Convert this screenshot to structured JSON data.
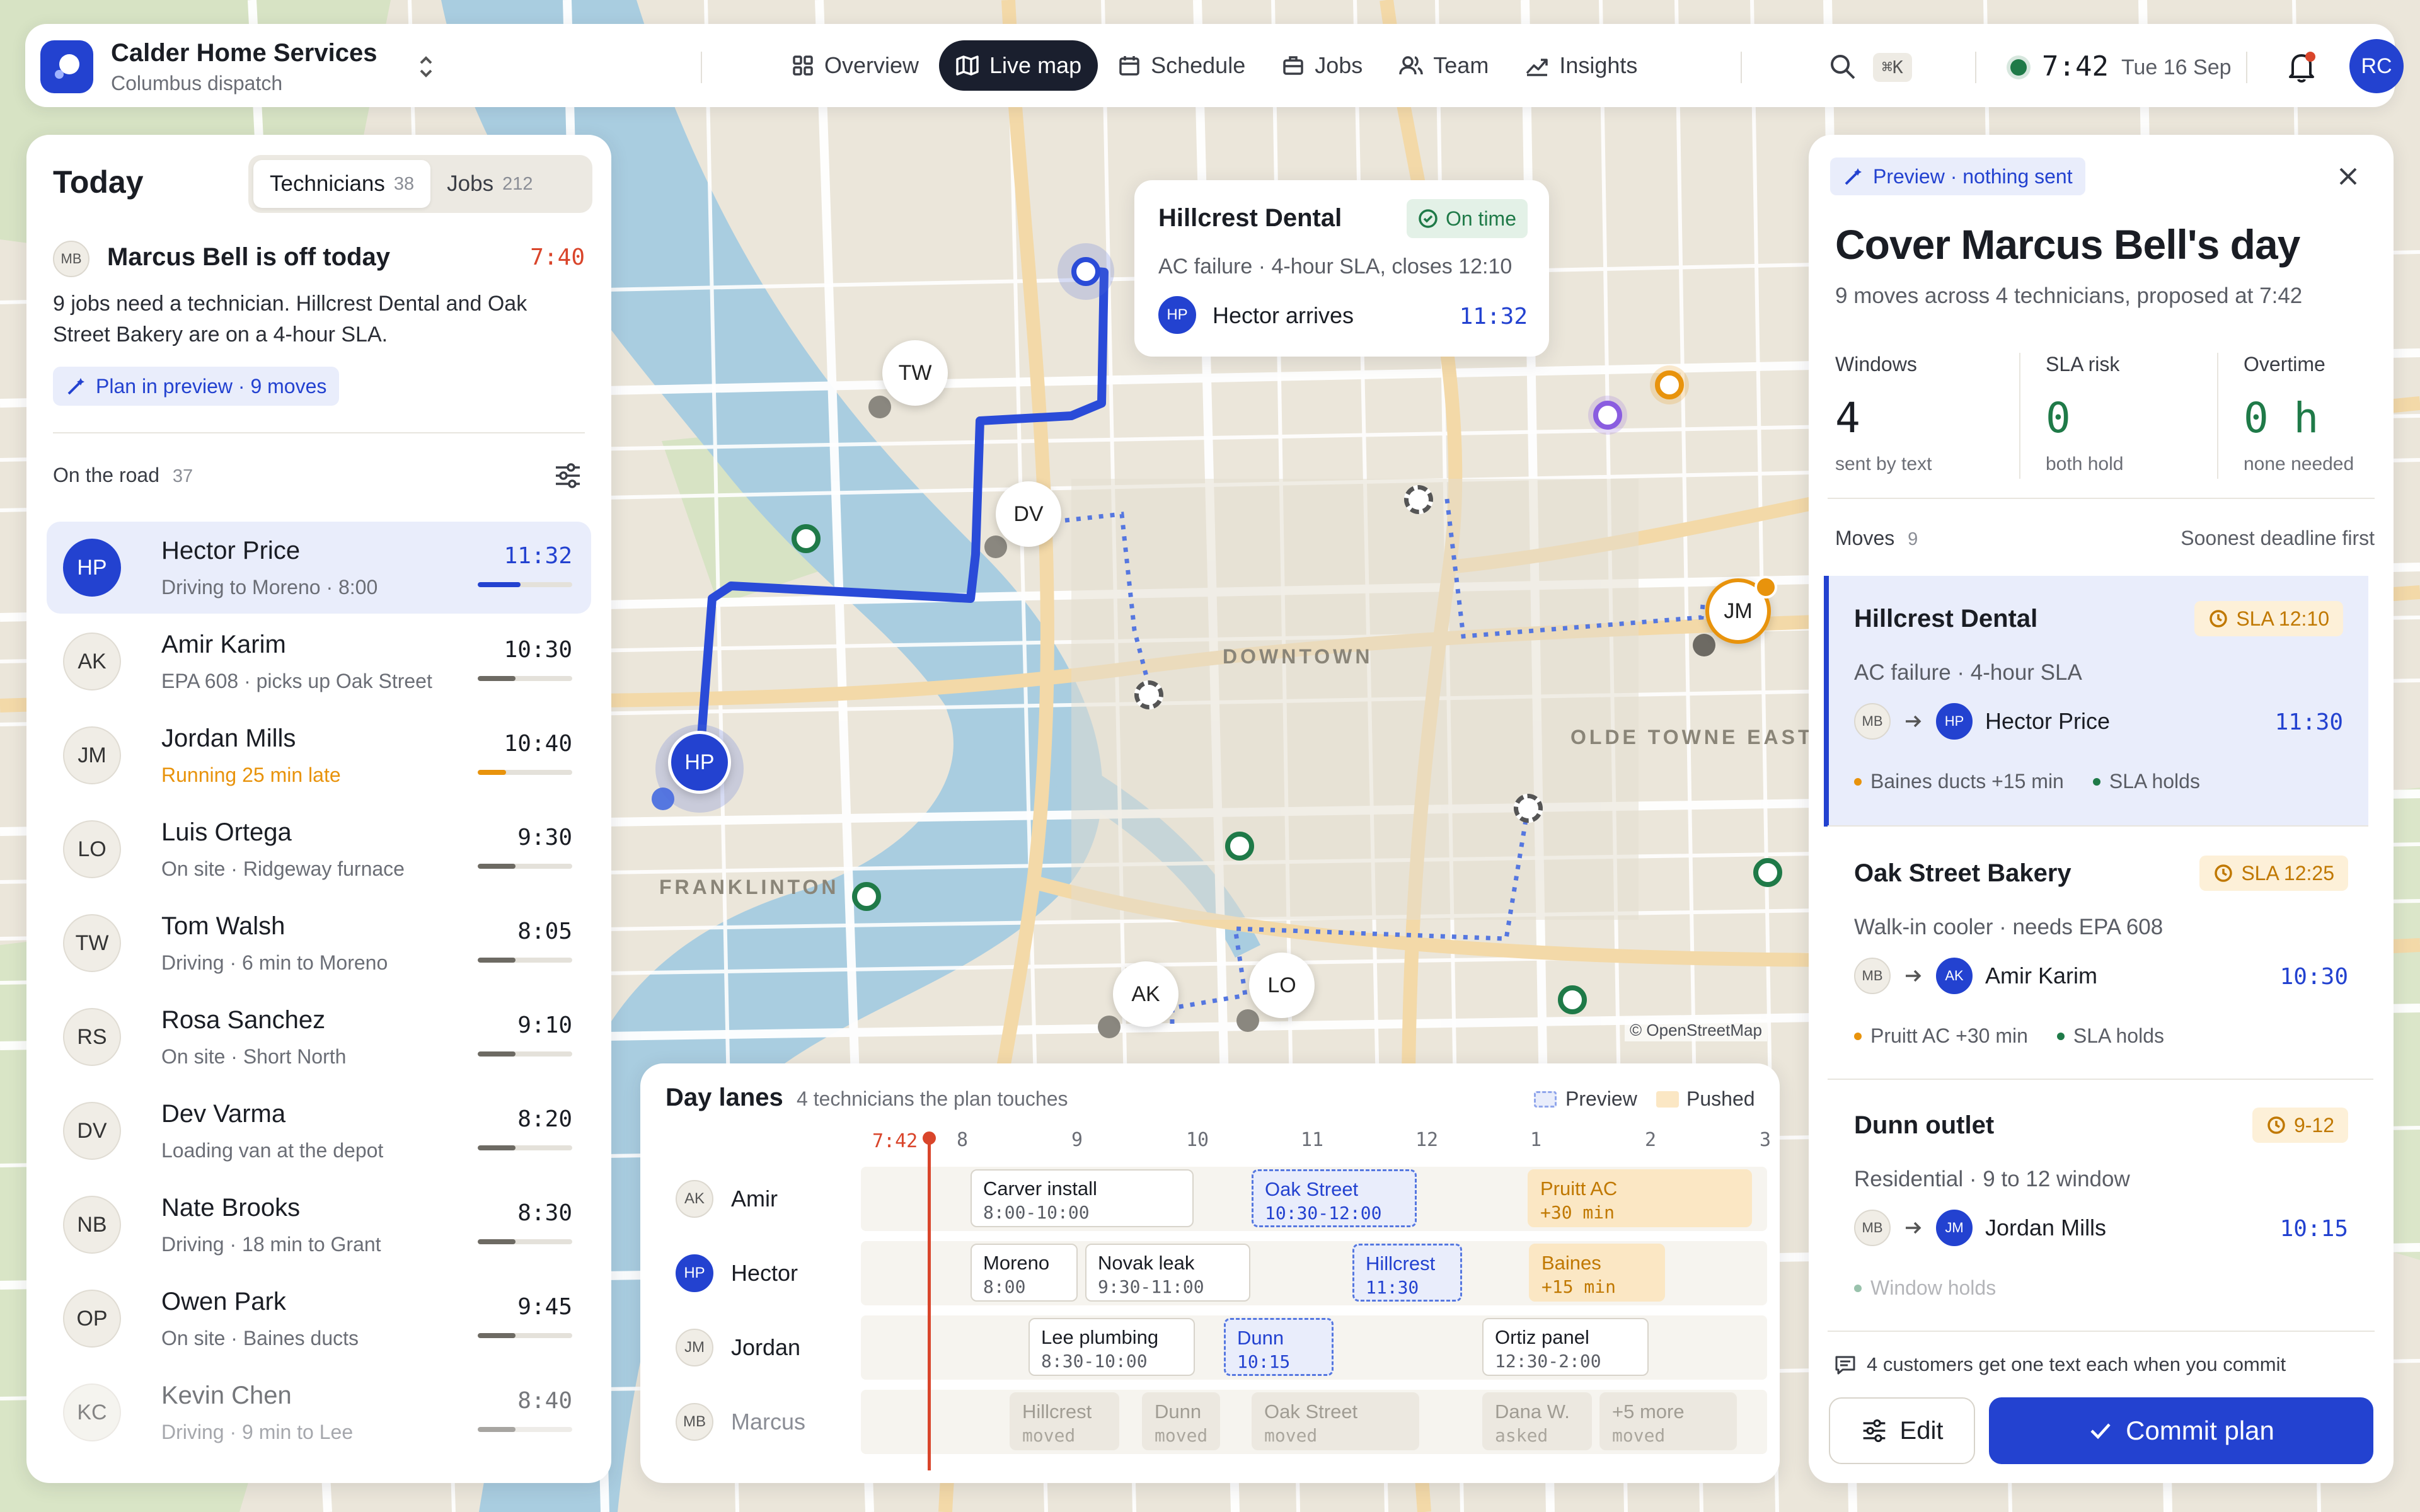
{
  "app": {
    "name": "Calder Home Services",
    "subtitle": "Columbus dispatch",
    "time": "7:42",
    "date": "Tue 16 Sep",
    "search_shortcut": "⌘K",
    "user_initials": "RC"
  },
  "nav": [
    {
      "label": "Overview",
      "icon": "grid-icon"
    },
    {
      "label": "Live map",
      "icon": "map-icon",
      "active": true
    },
    {
      "label": "Schedule",
      "icon": "calendar-icon"
    },
    {
      "label": "Jobs",
      "icon": "briefcase-icon"
    },
    {
      "label": "Team",
      "icon": "team-icon"
    },
    {
      "label": "Insights",
      "icon": "chart-icon"
    }
  ],
  "left": {
    "title": "Today",
    "tabs": [
      {
        "label": "Technicians",
        "count": "38"
      },
      {
        "label": "Jobs",
        "count": "212"
      }
    ],
    "alert": {
      "avatar": "MB",
      "title": "Marcus Bell is off today",
      "time": "7:40",
      "body": "9 jobs need a technician. Hillcrest Dental and Oak Street Bakery are on a 4-hour SLA.",
      "action": "Plan in preview · 9 moves"
    },
    "on_road_label": "On the road",
    "on_road_count": "37",
    "technicians": [
      {
        "initials": "HP",
        "name": "Hector Price",
        "status": "Driving to Moreno · 8:00",
        "time": "11:32",
        "progress": 0.45,
        "selected": true
      },
      {
        "initials": "AK",
        "name": "Amir Karim",
        "status": "EPA 608 · picks up Oak Street",
        "time": "10:30",
        "progress": 0.4
      },
      {
        "initials": "JM",
        "name": "Jordan Mills",
        "status": "Running 25 min late",
        "time": "10:40",
        "progress": 0.3,
        "late": true
      },
      {
        "initials": "LO",
        "name": "Luis Ortega",
        "status": "On site · Ridgeway furnace",
        "time": "9:30",
        "progress": 0.4
      },
      {
        "initials": "TW",
        "name": "Tom Walsh",
        "status": "Driving · 6 min to Moreno",
        "time": "8:05",
        "progress": 0.4
      },
      {
        "initials": "RS",
        "name": "Rosa Sanchez",
        "status": "On site · Short North",
        "time": "9:10",
        "progress": 0.4
      },
      {
        "initials": "DV",
        "name": "Dev Varma",
        "status": "Loading van at the depot",
        "time": "8:20",
        "progress": 0.4
      },
      {
        "initials": "NB",
        "name": "Nate Brooks",
        "status": "Driving · 18 min to Grant",
        "time": "8:30",
        "progress": 0.4
      },
      {
        "initials": "OP",
        "name": "Owen Park",
        "status": "On site · Baines ducts",
        "time": "9:45",
        "progress": 0.4
      },
      {
        "initials": "KC",
        "name": "Kevin Chen",
        "status": "Driving · 9 min to Lee",
        "time": "8:40",
        "progress": 0.4,
        "faded": true
      }
    ]
  },
  "map": {
    "labels": [
      "DOWNTOWN",
      "OLDE TOWNE EAST",
      "FRANKLINTON"
    ],
    "attribution": "© OpenStreetMap",
    "pins": [
      "TW",
      "DV",
      "HP",
      "JM",
      "AK",
      "LO"
    ]
  },
  "popup": {
    "title": "Hillcrest Dental",
    "badge": "On time",
    "desc": "AC failure · 4-hour SLA, closes 12:10",
    "tech_initials": "HP",
    "tech_text": "Hector arrives",
    "time": "11:32"
  },
  "lanes": {
    "title": "Day lanes",
    "subtitle": "4 technicians the plan touches",
    "legend_preview": "Preview",
    "legend_pushed": "Pushed",
    "now": "7:42",
    "ticks": [
      "8",
      "9",
      "10",
      "11",
      "12",
      "1",
      "2",
      "3"
    ],
    "rows": [
      {
        "initials": "AK",
        "name": "Amir",
        "blocks": [
          {
            "t1": "Carver install",
            "t2": "8:00-10:00",
            "kind": "normal"
          },
          {
            "t1": "Oak Street",
            "t2": "10:30-12:00",
            "kind": "prev"
          },
          {
            "t1": "Pruitt AC",
            "t2": "+30 min",
            "kind": "push"
          }
        ]
      },
      {
        "initials": "HP",
        "name": "Hector",
        "blue": true,
        "blocks": [
          {
            "t1": "Moreno",
            "t2": "8:00",
            "kind": "normal"
          },
          {
            "t1": "Novak leak",
            "t2": "9:30-11:00",
            "kind": "normal"
          },
          {
            "t1": "Hillcrest",
            "t2": "11:30",
            "kind": "prev"
          },
          {
            "t1": "Baines",
            "t2": "+15 min",
            "kind": "push"
          }
        ]
      },
      {
        "initials": "JM",
        "name": "Jordan",
        "blocks": [
          {
            "t1": "Lee plumbing",
            "t2": "8:30-10:00",
            "kind": "normal"
          },
          {
            "t1": "Dunn",
            "t2": "10:15",
            "kind": "prev"
          },
          {
            "t1": "Ortiz panel",
            "t2": "12:30-2:00",
            "kind": "normal"
          }
        ]
      },
      {
        "initials": "MB",
        "name": "Marcus",
        "muted": true,
        "blocks": [
          {
            "t1": "Hillcrest",
            "t2": "moved",
            "kind": "moved"
          },
          {
            "t1": "Dunn",
            "t2": "moved",
            "kind": "moved"
          },
          {
            "t1": "Oak Street",
            "t2": "moved",
            "kind": "moved"
          },
          {
            "t1": "Dana W.",
            "t2": "asked",
            "kind": "moved"
          },
          {
            "t1": "+5 more",
            "t2": "moved",
            "kind": "moved"
          }
        ]
      }
    ]
  },
  "right": {
    "preview_badge": "Preview · nothing sent",
    "title": "Cover Marcus Bell's day",
    "subtitle": "9 moves across 4 technicians, proposed at 7:42",
    "stats": [
      {
        "label": "Windows",
        "value": "4",
        "sub": "sent by text"
      },
      {
        "label": "SLA risk",
        "value": "0",
        "sub": "both hold"
      },
      {
        "label": "Overtime",
        "value": "0 h",
        "sub": "none needed"
      }
    ],
    "moves_label": "Moves",
    "moves_count": "9",
    "sort_label": "Soonest deadline first",
    "moves": [
      {
        "title": "Hillcrest Dental",
        "sla": "SLA 12:10",
        "desc": "AC failure · 4-hour SLA",
        "from": "MB",
        "to_initials": "HP",
        "to_name": "Hector Price",
        "time": "11:30",
        "note1": "Baines ducts +15 min",
        "note2": "SLA holds",
        "selected": true
      },
      {
        "title": "Oak Street Bakery",
        "sla": "SLA 12:25",
        "desc": "Walk-in cooler · needs EPA 608",
        "from": "MB",
        "to_initials": "AK",
        "to_name": "Amir Karim",
        "time": "10:30",
        "note1": "Pruitt AC +30 min",
        "note2": "SLA holds"
      },
      {
        "title": "Dunn outlet",
        "sla": "9-12",
        "desc": "Residential · 9 to 12 window",
        "from": "MB",
        "to_initials": "JM",
        "to_name": "Jordan Mills",
        "time": "10:15",
        "note2": "Window holds"
      }
    ],
    "footer_note": "4 customers get one text each when you commit",
    "edit_label": "Edit",
    "commit_label": "Commit plan"
  },
  "colors": {
    "accent": "#2342d0",
    "late": "#e8930c",
    "alert_time": "#d9452b",
    "ok_green": "#1f7a48"
  }
}
